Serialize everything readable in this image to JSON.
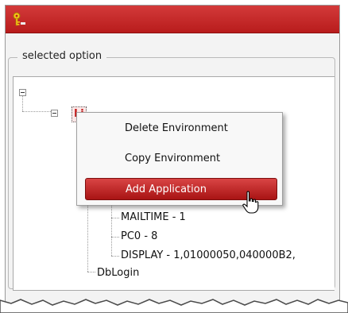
{
  "window": {
    "group_label": "selected option"
  },
  "tree": {
    "selected_node": "Li",
    "children": [
      {
        "label": "MAILTIME - 1"
      },
      {
        "label": "PC0 - 8"
      },
      {
        "label": "DISPLAY - 1,01000050,040000B2,"
      }
    ],
    "sibling": "DbLogin"
  },
  "context_menu": {
    "items": [
      {
        "label": "Delete Environment"
      },
      {
        "label": "Copy Environment"
      },
      {
        "label": "Add Application"
      }
    ],
    "highlighted": "Add Application"
  },
  "colors": {
    "title_bar": "#c52a2a",
    "highlight": "#b81c1c",
    "selected_text": "#c21a1a"
  },
  "icons": {
    "app": "key-icon",
    "expander": "minus-box-icon",
    "cursor": "hand-pointer-icon"
  }
}
